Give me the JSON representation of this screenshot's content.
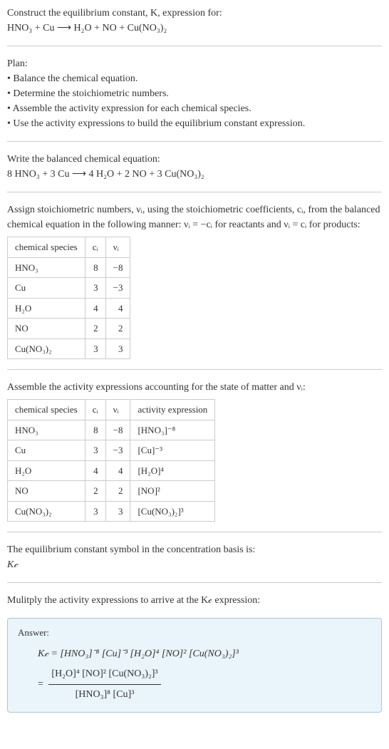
{
  "header": {
    "l1": "Construct the equilibrium constant, K, expression for:",
    "l2": "HNO₃ + Cu ⟶ H₂O + NO + Cu(NO₃)₂"
  },
  "plan": {
    "title": "Plan:",
    "b1": "• Balance the chemical equation.",
    "b2": "• Determine the stoichiometric numbers.",
    "b3": "• Assemble the activity expression for each chemical species.",
    "b4": "• Use the activity expressions to build the equilibrium constant expression."
  },
  "balanced": {
    "title": "Write the balanced chemical equation:",
    "eq": "8 HNO₃ + 3 Cu ⟶ 4 H₂O + 2 NO + 3 Cu(NO₃)₂"
  },
  "stoich": {
    "intro": "Assign stoichiometric numbers, νᵢ, using the stoichiometric coefficients, cᵢ, from the balanced chemical equation in the following manner: νᵢ = −cᵢ for reactants and νᵢ = cᵢ for products:",
    "h1": "chemical species",
    "h2": "cᵢ",
    "h3": "νᵢ",
    "r1": {
      "s": "HNO₃",
      "c": "8",
      "v": "−8"
    },
    "r2": {
      "s": "Cu",
      "c": "3",
      "v": "−3"
    },
    "r3": {
      "s": "H₂O",
      "c": "4",
      "v": "4"
    },
    "r4": {
      "s": "NO",
      "c": "2",
      "v": "2"
    },
    "r5": {
      "s": "Cu(NO₃)₂",
      "c": "3",
      "v": "3"
    }
  },
  "activity": {
    "intro": "Assemble the activity expressions accounting for the state of matter and νᵢ:",
    "h1": "chemical species",
    "h2": "cᵢ",
    "h3": "νᵢ",
    "h4": "activity expression",
    "r1": {
      "s": "HNO₃",
      "c": "8",
      "v": "−8",
      "a": "[HNO₃]⁻⁸"
    },
    "r2": {
      "s": "Cu",
      "c": "3",
      "v": "−3",
      "a": "[Cu]⁻³"
    },
    "r3": {
      "s": "H₂O",
      "c": "4",
      "v": "4",
      "a": "[H₂O]⁴"
    },
    "r4": {
      "s": "NO",
      "c": "2",
      "v": "2",
      "a": "[NO]²"
    },
    "r5": {
      "s": "Cu(NO₃)₂",
      "c": "3",
      "v": "3",
      "a": "[Cu(NO₃)₂]³"
    }
  },
  "kcname": {
    "l1": "The equilibrium constant symbol in the concentration basis is:",
    "l2": "K𝒸"
  },
  "multiply": "Mulitply the activity expressions to arrive at the K𝒸 expression:",
  "answer": {
    "label": "Answer:",
    "line1": "K𝒸 = [HNO₃]⁻⁸ [Cu]⁻³ [H₂O]⁴ [NO]² [Cu(NO₃)₂]³",
    "eqsign": "= ",
    "num": "[H₂O]⁴ [NO]² [Cu(NO₃)₂]³",
    "den": "[HNO₃]⁸ [Cu]³"
  }
}
